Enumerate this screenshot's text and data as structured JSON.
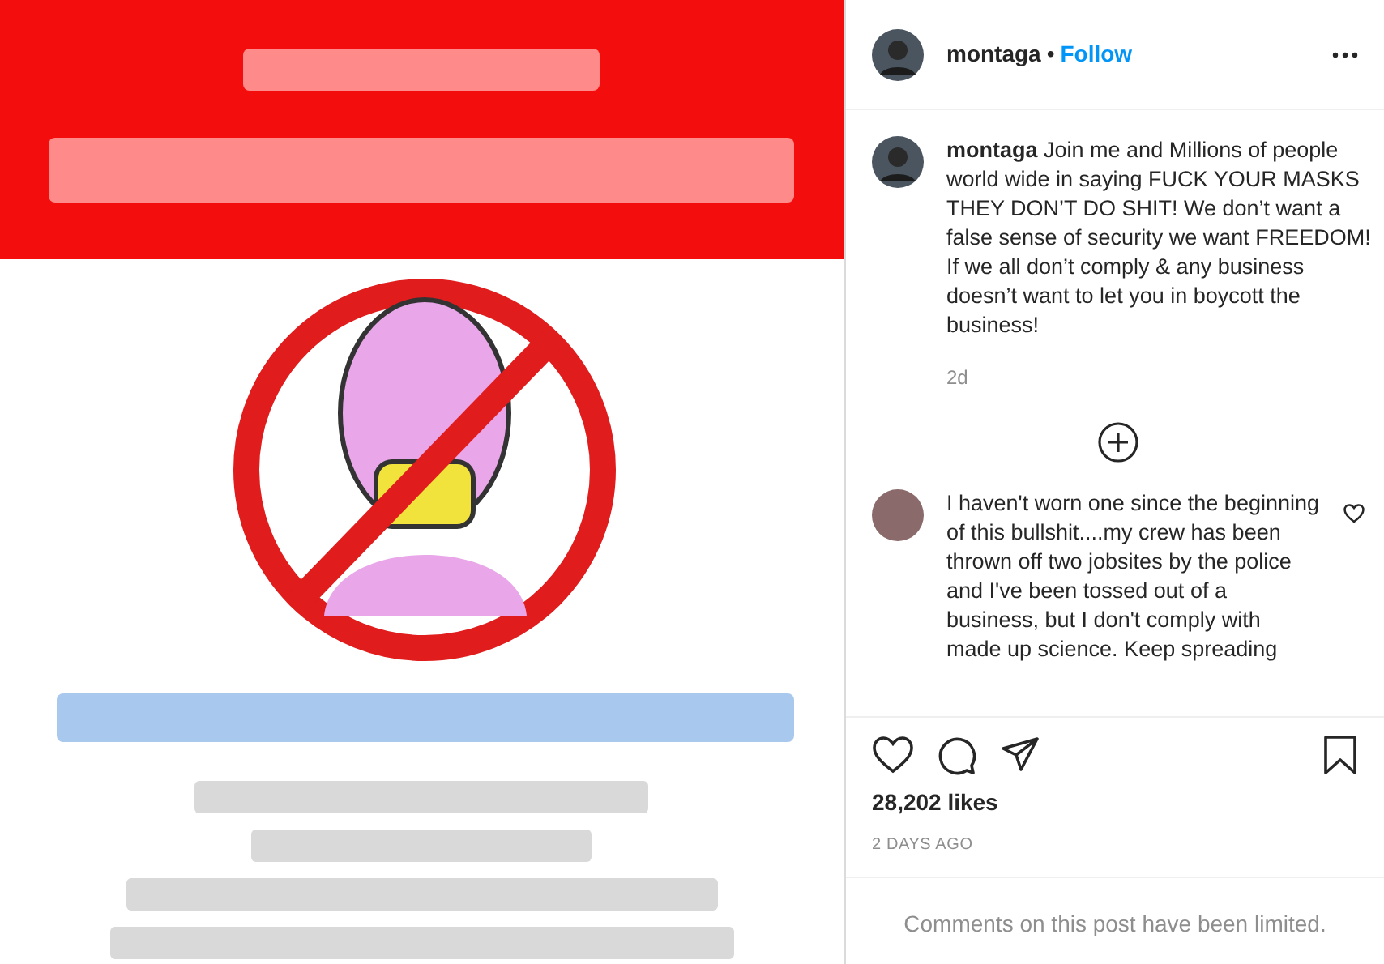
{
  "header": {
    "username": "montaga",
    "separator": "•",
    "follow": "Follow"
  },
  "caption": {
    "username": "montaga",
    "text": "Join me and Millions of people world wide in saying FUCK YOUR MASKS THEY DON’T DO SHIT! We don’t want a false sense of security we want FREEDOM! If we all don’t comply & any business doesn’t want to let you in boycott the business!",
    "age": "2d"
  },
  "comments": [
    {
      "text": "I haven't worn one since the beginning of this bullshit....my crew has been thrown off two jobsites by the police and I've been tossed out of a business, but I don't comply with made up science. Keep spreading",
      "liked": false
    }
  ],
  "likes": "28,202 likes",
  "date": "2 DAYS AGO",
  "comments_notice": "Comments on this post have been limited."
}
